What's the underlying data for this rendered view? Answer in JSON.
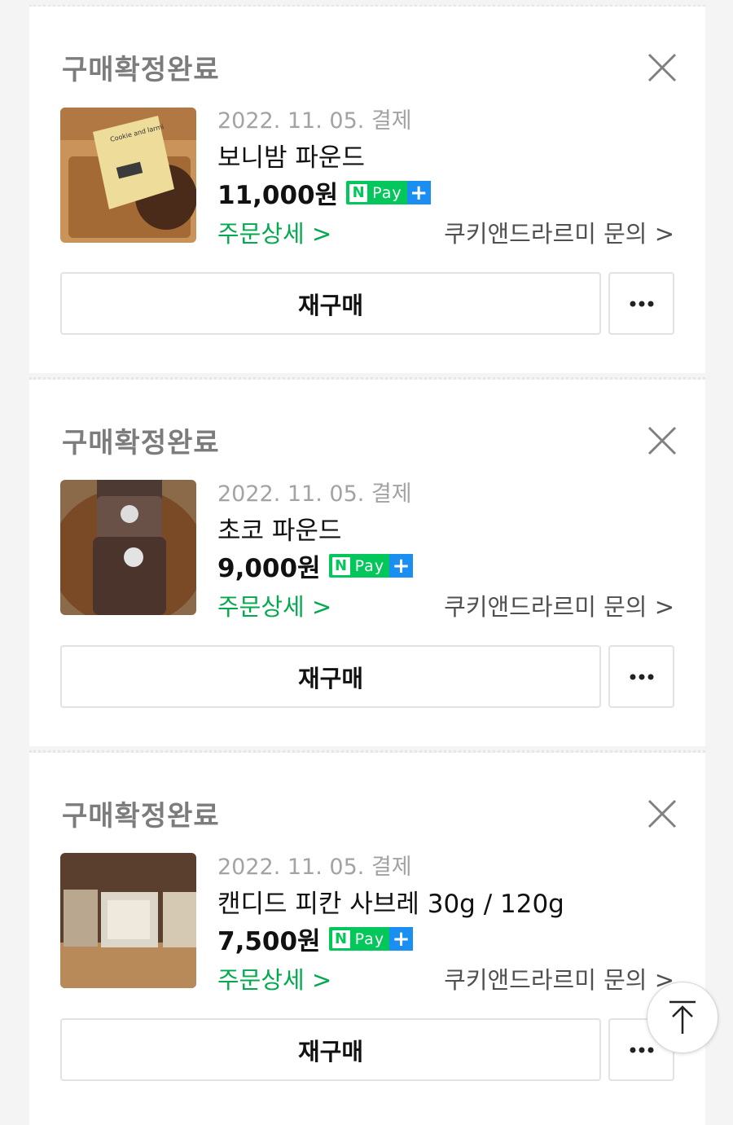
{
  "orders": [
    {
      "status": "구매확정완료",
      "date": "2022. 11. 05. 결제",
      "product_name": "보니밤 파운드",
      "price": "11,000원",
      "order_detail_label": "주문상세 >",
      "inquiry_label": "쿠키앤드라르미 문의 >",
      "rebuy_label": "재구매",
      "thumbnail_text": "Cookie and larmi"
    },
    {
      "status": "구매확정완료",
      "date": "2022. 11. 05. 결제",
      "product_name": "초코 파운드",
      "price": "9,000원",
      "order_detail_label": "주문상세 >",
      "inquiry_label": "쿠키앤드라르미 문의 >",
      "rebuy_label": "재구매"
    },
    {
      "status": "구매확정완료",
      "date": "2022. 11. 05. 결제",
      "product_name": "캔디드 피칸 사브레 30g / 120g",
      "price": "7,500원",
      "order_detail_label": "주문상세 >",
      "inquiry_label": "쿠키앤드라르미 문의 >",
      "rebuy_label": "재구매"
    }
  ],
  "npay": {
    "n": "N",
    "pay": "Pay",
    "plus": "+"
  },
  "colors": {
    "accent_green": "#03a94e",
    "npay_green": "#03c75a",
    "npay_blue": "#1b8ef2"
  },
  "icons": {
    "close": "close-icon",
    "more": "more-dots-icon",
    "scroll_top": "arrow-up-icon"
  }
}
